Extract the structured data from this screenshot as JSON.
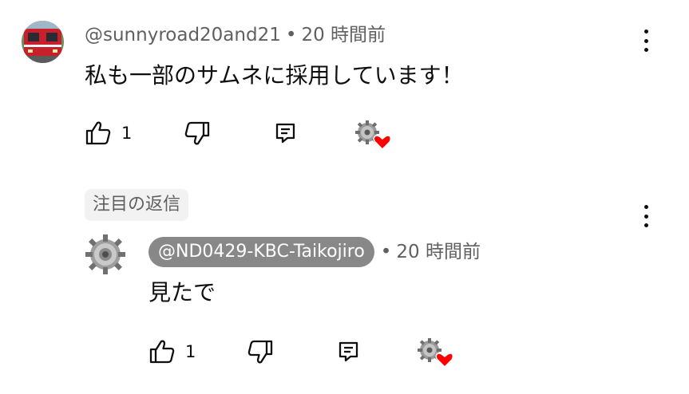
{
  "comment": {
    "author": "@sunnyroad20and21",
    "separator": "•",
    "time": "20 時間前",
    "text": "私も一部のサムネに採用しています！",
    "like_count": "1",
    "avatar": "train-photo-avatar",
    "heart_avatar": "creator-heart-icon"
  },
  "chip": {
    "label": "注目の返信"
  },
  "reply": {
    "author": "@ND0429-KBC-Taikojiro",
    "separator": "•",
    "time": "20 時間前",
    "text": "見たで",
    "like_count": "1",
    "avatar": "gear-avatar",
    "heart_avatar": "creator-heart-icon"
  },
  "colors": {
    "heart": "#ff0000",
    "meta_text": "#606060",
    "owner_pill_bg": "#888888",
    "chip_bg": "#f2f2f2"
  },
  "icons": [
    "like-icon",
    "dislike-icon",
    "reply-icon",
    "more-vert-icon",
    "heart-icon"
  ]
}
